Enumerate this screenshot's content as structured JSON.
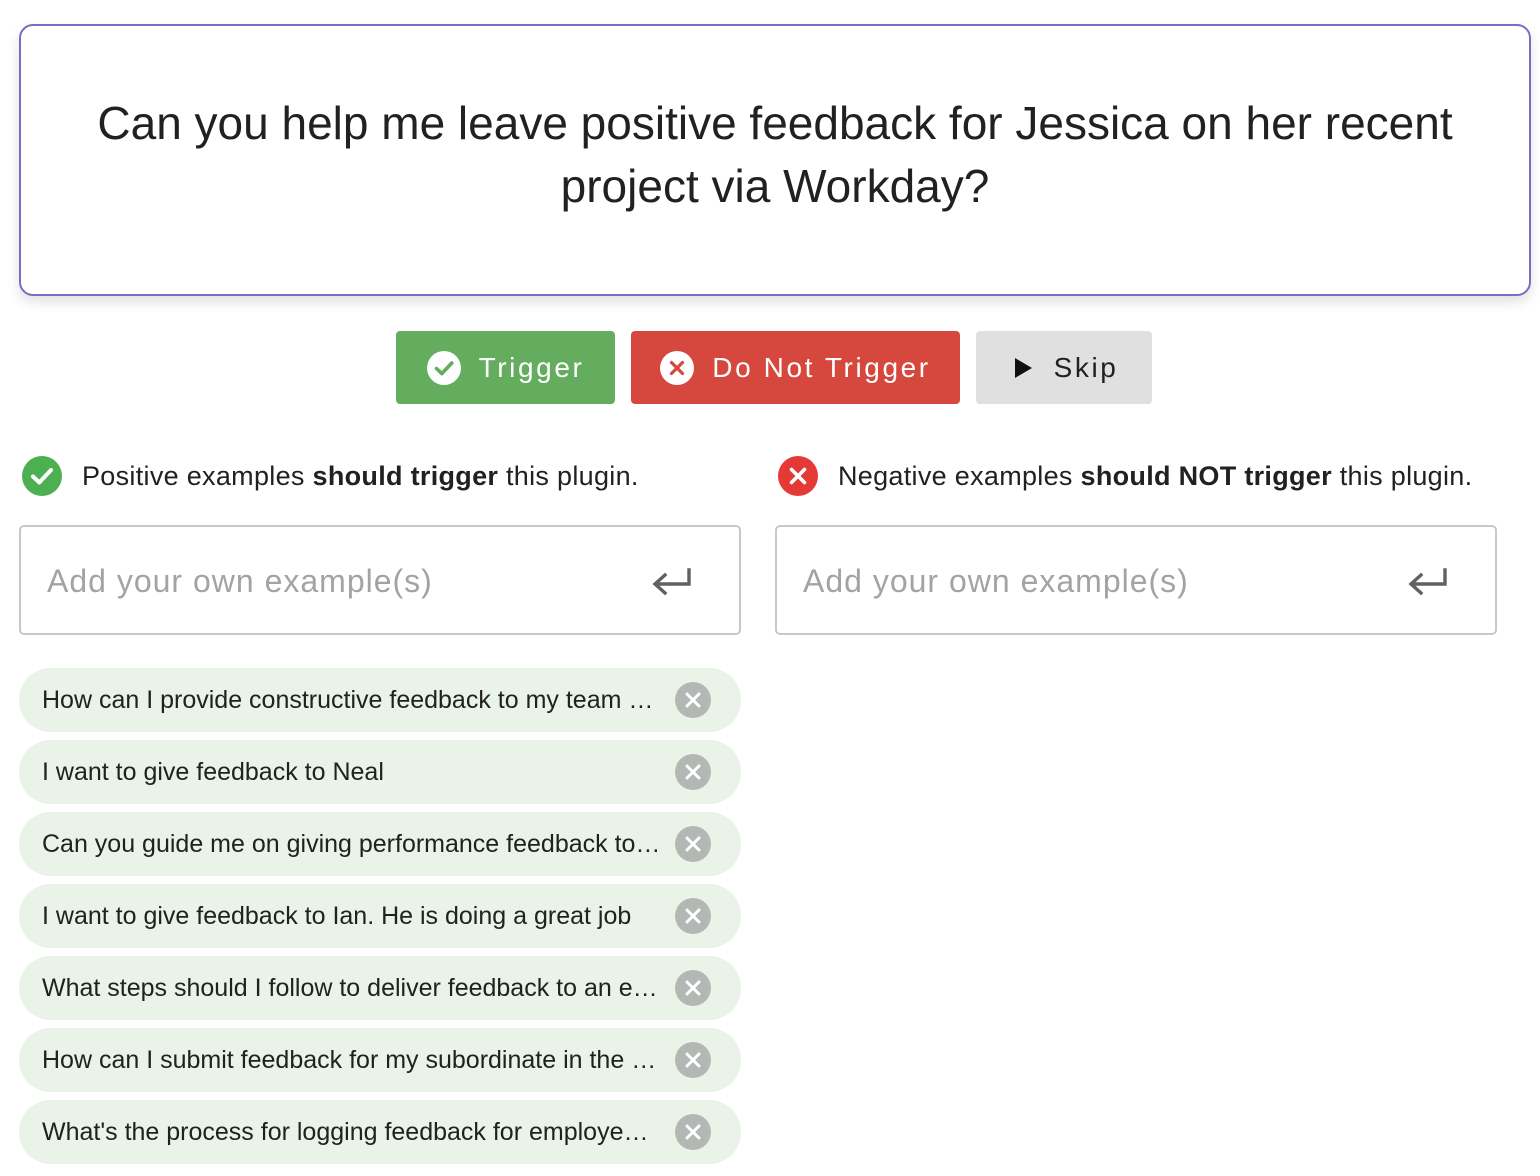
{
  "prompt": {
    "text": "Can you help me leave positive feedback for Jessica on her recent project via Workday?"
  },
  "actions": {
    "trigger_label": "Trigger",
    "do_not_trigger_label": "Do Not Trigger",
    "skip_label": "Skip"
  },
  "colors": {
    "accent_border": "#7e6bc4",
    "trigger": "#65ad5e",
    "do_not_trigger": "#d6473e",
    "skip": "#e0e0e0",
    "positive_chip": "#e9f3e7"
  },
  "positive": {
    "header_prefix": "Positive examples ",
    "header_bold": "should trigger",
    "header_suffix": " this plugin.",
    "input_placeholder": "Add your own example(s)",
    "examples": [
      "How can I provide constructive feedback to my team member on their recent work in Workday?",
      "I want to give feedback to Neal",
      "Can you guide me on giving performance feedback to a colleague?",
      "I want to give feedback to Ian. He is doing a great job",
      "What steps should I follow to deliver feedback to an employee?",
      "How can I submit feedback for my subordinate in the system?",
      "What's the process for logging feedback for employees in Workday?"
    ]
  },
  "negative": {
    "header_prefix": "Negative examples ",
    "header_bold": "should NOT trigger",
    "header_suffix": " this plugin.",
    "input_placeholder": "Add your own example(s)"
  },
  "icons": {
    "trigger": "check-circle-icon",
    "do_not_trigger": "x-circle-icon",
    "skip": "play-icon",
    "enter": "enter-return-icon",
    "remove": "remove-circle-icon"
  }
}
